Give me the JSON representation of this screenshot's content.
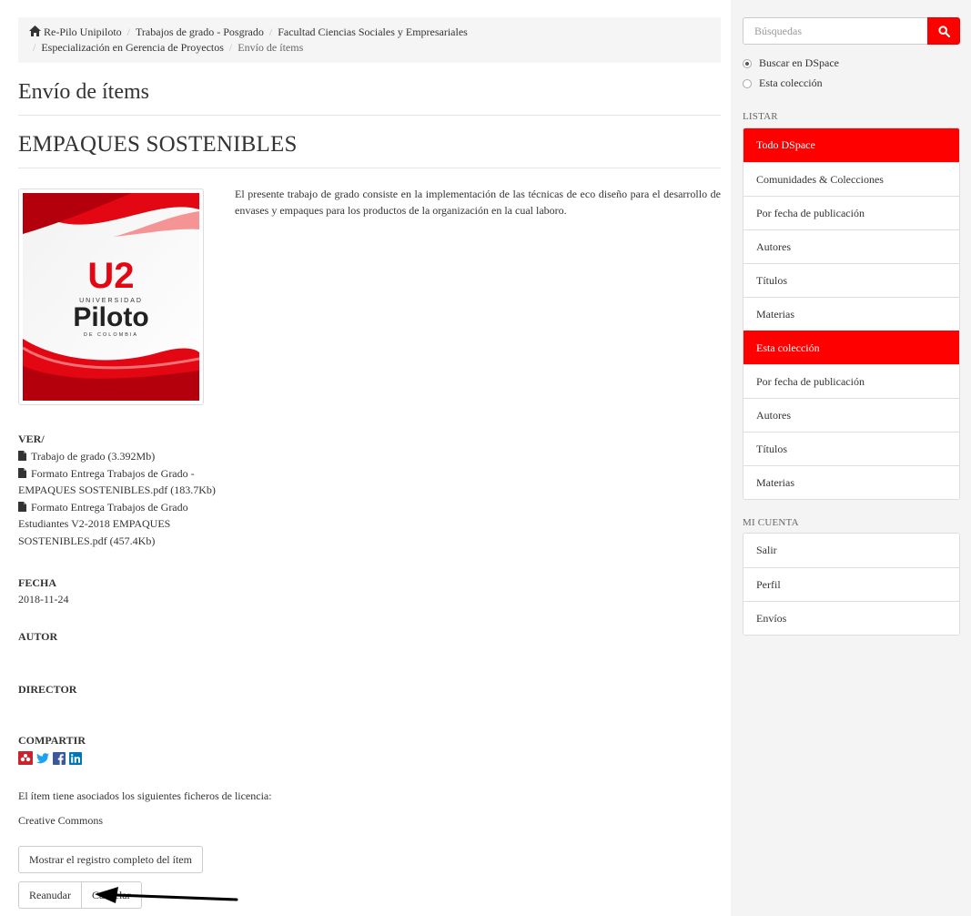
{
  "breadcrumb": {
    "items": [
      "Re-Pilo Unipiloto",
      "Trabajos de grado - Posgrado",
      "Facultad Ciencias Sociales y Empresariales",
      "Especialización en Gerencia de Proyectos"
    ],
    "current": "Envío de ítems"
  },
  "page_title": "Envío de ítems",
  "item_title": "EMPAQUES SOSTENIBLES",
  "abstract": "El presente trabajo de grado consiste en la implementación de las técnicas de eco diseño para el desarrollo de envases y empaques para los productos de la organización en la cual laboro.",
  "thumbnail": {
    "logo_mark": "U2",
    "logo_line1": "UNIVERSIDAD",
    "logo_line2": "Piloto",
    "logo_line3": "DE COLOMBIA"
  },
  "files": {
    "heading": "VER/",
    "items": [
      "Trabajo de grado (3.392Mb)",
      "Formato Entrega Trabajos de Grado - EMPAQUES SOSTENIBLES.pdf (183.7Kb)",
      "Formato Entrega Trabajos de Grado Estudiantes V2-2018 EMPAQUES SOSTENIBLES.pdf (457.4Kb)"
    ]
  },
  "fecha": {
    "heading": "FECHA",
    "value": "2018-11-24"
  },
  "autor": {
    "heading": "AUTOR"
  },
  "director": {
    "heading": "DIRECTOR"
  },
  "compartir": {
    "heading": "COMPARTIR"
  },
  "license_text": "El ítem tiene asociados los siguientes ficheros de licencia:",
  "license_name": "Creative Commons",
  "buttons": {
    "full_record": "Mostrar el registro completo del ítem",
    "resume": "Reanudar",
    "cancel": "Cancelar"
  },
  "sidebar": {
    "search_placeholder": "Búsquedas",
    "scope_options": [
      "Buscar en DSpace",
      "Esta colección"
    ],
    "listar_heading": "LISTAR",
    "listar_items": [
      {
        "label": "Todo DSpace",
        "active": true
      },
      {
        "label": "Comunidades & Colecciones",
        "active": false
      },
      {
        "label": "Por fecha de publicación",
        "active": false
      },
      {
        "label": "Autores",
        "active": false
      },
      {
        "label": "Títulos",
        "active": false
      },
      {
        "label": "Materias",
        "active": false
      },
      {
        "label": "Esta colección",
        "active": true
      },
      {
        "label": "Por fecha de publicación",
        "active": false
      },
      {
        "label": "Autores",
        "active": false
      },
      {
        "label": "Títulos",
        "active": false
      },
      {
        "label": "Materias",
        "active": false
      }
    ],
    "cuenta_heading": "MI CUENTA",
    "cuenta_items": [
      "Salir",
      "Perfil",
      "Envíos"
    ]
  },
  "colors": {
    "accent": "#ff0000",
    "share_mendeley": "#c9232e",
    "share_twitter": "#1da1f2",
    "share_facebook": "#3b5998",
    "share_linkedin": "#0077b5"
  },
  "icons": [
    "home-icon",
    "file-icon",
    "search-icon",
    "mendeley-icon",
    "twitter-icon",
    "facebook-icon",
    "linkedin-icon",
    "arrow-left-icon"
  ]
}
